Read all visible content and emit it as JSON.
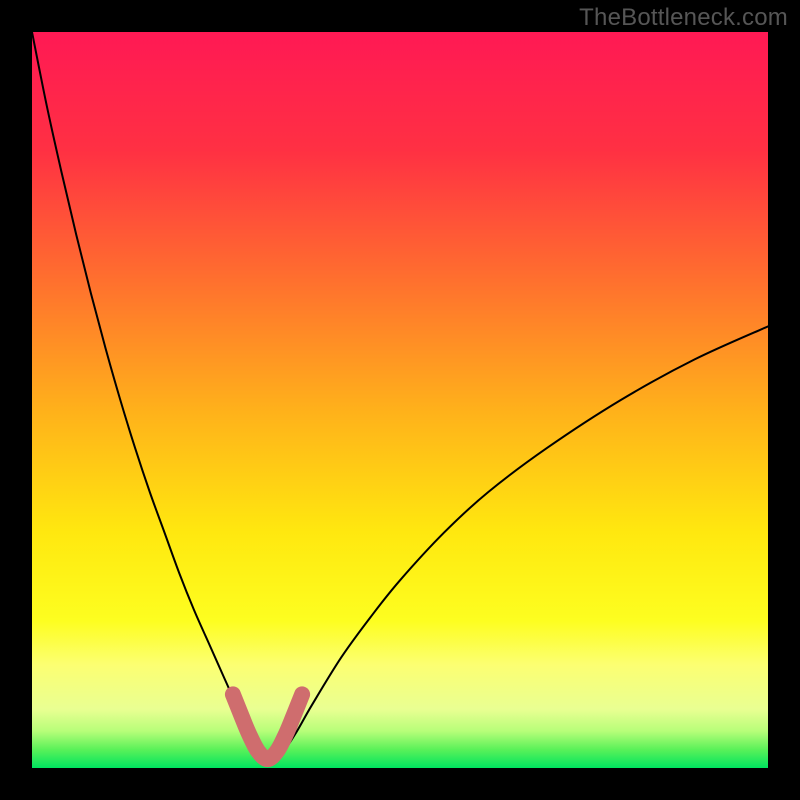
{
  "watermark": "TheBottleneck.com",
  "chart_data": {
    "type": "line",
    "title": "",
    "xlabel": "",
    "ylabel": "",
    "xlim": [
      0,
      100
    ],
    "ylim": [
      0,
      100
    ],
    "grid": false,
    "legend": false,
    "gradient_stops": [
      {
        "offset": 0.0,
        "color": "#ff1954"
      },
      {
        "offset": 0.16,
        "color": "#ff3043"
      },
      {
        "offset": 0.33,
        "color": "#ff6d2f"
      },
      {
        "offset": 0.52,
        "color": "#ffb31a"
      },
      {
        "offset": 0.68,
        "color": "#ffe80f"
      },
      {
        "offset": 0.8,
        "color": "#fdfe20"
      },
      {
        "offset": 0.86,
        "color": "#fcff72"
      },
      {
        "offset": 0.92,
        "color": "#e9ff92"
      },
      {
        "offset": 0.95,
        "color": "#b7fe79"
      },
      {
        "offset": 0.975,
        "color": "#5af159"
      },
      {
        "offset": 1.0,
        "color": "#00e45f"
      }
    ],
    "series": [
      {
        "name": "bottleneck-curve",
        "stroke": "#000000",
        "stroke_width": 2,
        "x": [
          0,
          2,
          4,
          6,
          8,
          10,
          12,
          14,
          16,
          18,
          20,
          22,
          24,
          26,
          28,
          29,
          30,
          31,
          32,
          33,
          34,
          36,
          38,
          42,
          46,
          50,
          56,
          62,
          70,
          80,
          90,
          100
        ],
        "values": [
          100,
          90,
          81,
          72.5,
          64.5,
          57,
          50,
          43.5,
          37.5,
          32,
          26.5,
          21.5,
          17,
          12.5,
          8,
          5.5,
          3.5,
          2,
          1.2,
          1.2,
          2,
          5,
          8.5,
          15,
          20.5,
          25.5,
          32,
          37.5,
          43.5,
          50,
          55.5,
          60
        ]
      },
      {
        "name": "valley-highlight",
        "stroke": "#cf6d6e",
        "stroke_width": 16,
        "x": [
          27.3,
          28.5,
          29.5,
          30.7,
          32,
          33.3,
          34.5,
          35.5,
          36.7
        ],
        "values": [
          10,
          7,
          4.6,
          2.3,
          1.2,
          2.3,
          4.6,
          7,
          10
        ]
      }
    ]
  }
}
